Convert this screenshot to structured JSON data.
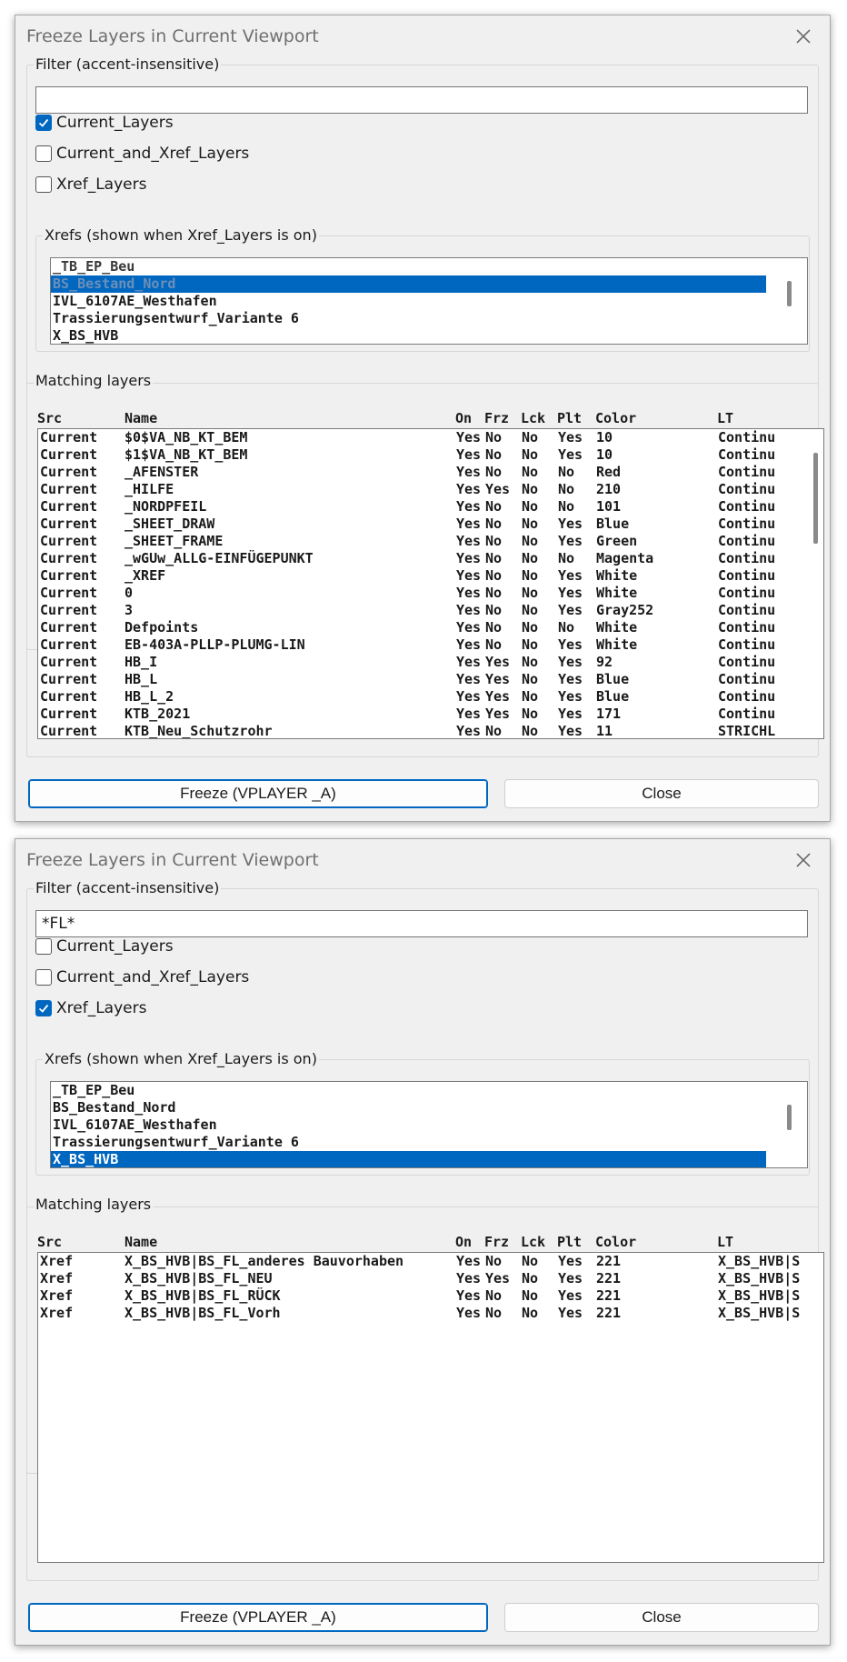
{
  "dialogs": [
    {
      "title": "Freeze Layers in Current Viewport",
      "filter_label": "Filter (accent-insensitive)",
      "filter_value": "",
      "checks": [
        {
          "label": "Current_Layers",
          "checked": true
        },
        {
          "label": "Current_and_Xref_Layers",
          "checked": false
        },
        {
          "label": "Xref_Layers",
          "checked": false
        }
      ],
      "xrefs_label": "Xrefs (shown when Xref_Layers is on)",
      "xrefs": [
        {
          "label": "_TB_EP_Beu",
          "selected": false
        },
        {
          "label": "BS_Bestand_Nord",
          "selected": true
        },
        {
          "label": "IVL_6107AE_Westhafen",
          "selected": false
        },
        {
          "label": "Trassierungsentwurf_Variante 6",
          "selected": false
        },
        {
          "label": "X_BS_HVB",
          "selected": false
        }
      ],
      "matching_label": "Matching layers",
      "columns": [
        "Src",
        "Name",
        "On",
        "Frz",
        "Lck",
        "Plt",
        "Color",
        "LT"
      ],
      "rows": [
        [
          "Current",
          "$0$VA_NB_KT_BEM",
          "Yes",
          "No",
          "No",
          "Yes",
          "10",
          "Continu"
        ],
        [
          "Current",
          "$1$VA_NB_KT_BEM",
          "Yes",
          "No",
          "No",
          "Yes",
          "10",
          "Continu"
        ],
        [
          "Current",
          "_AFENSTER",
          "Yes",
          "No",
          "No",
          "No",
          "Red",
          "Continu"
        ],
        [
          "Current",
          "_HILFE",
          "Yes",
          "Yes",
          "No",
          "No",
          "210",
          "Continu"
        ],
        [
          "Current",
          "_NORDPFEIL",
          "Yes",
          "No",
          "No",
          "No",
          "101",
          "Continu"
        ],
        [
          "Current",
          "_SHEET_DRAW",
          "Yes",
          "No",
          "No",
          "Yes",
          "Blue",
          "Continu"
        ],
        [
          "Current",
          "_SHEET_FRAME",
          "Yes",
          "No",
          "No",
          "Yes",
          "Green",
          "Continu"
        ],
        [
          "Current",
          "_wGUw_ALLG-EINFÜGEPUNKT",
          "Yes",
          "No",
          "No",
          "No",
          "Magenta",
          "Continu"
        ],
        [
          "Current",
          "_XREF",
          "Yes",
          "No",
          "No",
          "Yes",
          "White",
          "Continu"
        ],
        [
          "Current",
          "0",
          "Yes",
          "No",
          "No",
          "Yes",
          "White",
          "Continu"
        ],
        [
          "Current",
          "3",
          "Yes",
          "No",
          "No",
          "Yes",
          "Gray252",
          "Continu"
        ],
        [
          "Current",
          "Defpoints",
          "Yes",
          "No",
          "No",
          "No",
          "White",
          "Continu"
        ],
        [
          "Current",
          "EB-403A-PLLP-PLUMG-LIN",
          "Yes",
          "No",
          "No",
          "Yes",
          "White",
          "Continu"
        ],
        [
          "Current",
          "HB_I",
          "Yes",
          "Yes",
          "No",
          "Yes",
          "92",
          "Continu"
        ],
        [
          "Current",
          "HB_L",
          "Yes",
          "Yes",
          "No",
          "Yes",
          "Blue",
          "Continu"
        ],
        [
          "Current",
          "HB_L_2",
          "Yes",
          "Yes",
          "No",
          "Yes",
          "Blue",
          "Continu"
        ],
        [
          "Current",
          "KTB_2021",
          "Yes",
          "Yes",
          "No",
          "Yes",
          "171",
          "Continu"
        ],
        [
          "Current",
          "KTB_Neu_Schutzrohr",
          "Yes",
          "No",
          "No",
          "Yes",
          "11",
          "STRICHL"
        ]
      ],
      "freeze_button": "Freeze (VPLAYER _A)",
      "close_button": "Close"
    },
    {
      "title": "Freeze Layers in Current Viewport",
      "filter_label": "Filter (accent-insensitive)",
      "filter_value": "*FL*",
      "checks": [
        {
          "label": "Current_Layers",
          "checked": false
        },
        {
          "label": "Current_and_Xref_Layers",
          "checked": false
        },
        {
          "label": "Xref_Layers",
          "checked": true
        }
      ],
      "xrefs_label": "Xrefs (shown when Xref_Layers is on)",
      "xrefs": [
        {
          "label": "_TB_EP_Beu",
          "selected": false
        },
        {
          "label": "BS_Bestand_Nord",
          "selected": false
        },
        {
          "label": "IVL_6107AE_Westhafen",
          "selected": false
        },
        {
          "label": "Trassierungsentwurf_Variante 6",
          "selected": false
        },
        {
          "label": "X_BS_HVB",
          "selected": true
        }
      ],
      "matching_label": "Matching layers",
      "columns": [
        "Src",
        "Name",
        "On",
        "Frz",
        "Lck",
        "Plt",
        "Color",
        "LT"
      ],
      "rows": [
        [
          "Xref",
          "X_BS_HVB|BS_FL_anderes Bauvorhaben",
          "Yes",
          "No",
          "No",
          "Yes",
          "221",
          "X_BS_HVB|S"
        ],
        [
          "Xref",
          "X_BS_HVB|BS_FL_NEU",
          "Yes",
          "Yes",
          "No",
          "Yes",
          "221",
          "X_BS_HVB|S"
        ],
        [
          "Xref",
          "X_BS_HVB|BS_FL_RÜCK",
          "Yes",
          "No",
          "No",
          "Yes",
          "221",
          "X_BS_HVB|S"
        ],
        [
          "Xref",
          "X_BS_HVB|BS_FL_Vorh",
          "Yes",
          "No",
          "No",
          "Yes",
          "221",
          "X_BS_HVB|S"
        ]
      ],
      "freeze_button": "Freeze (VPLAYER _A)",
      "close_button": "Close"
    }
  ]
}
